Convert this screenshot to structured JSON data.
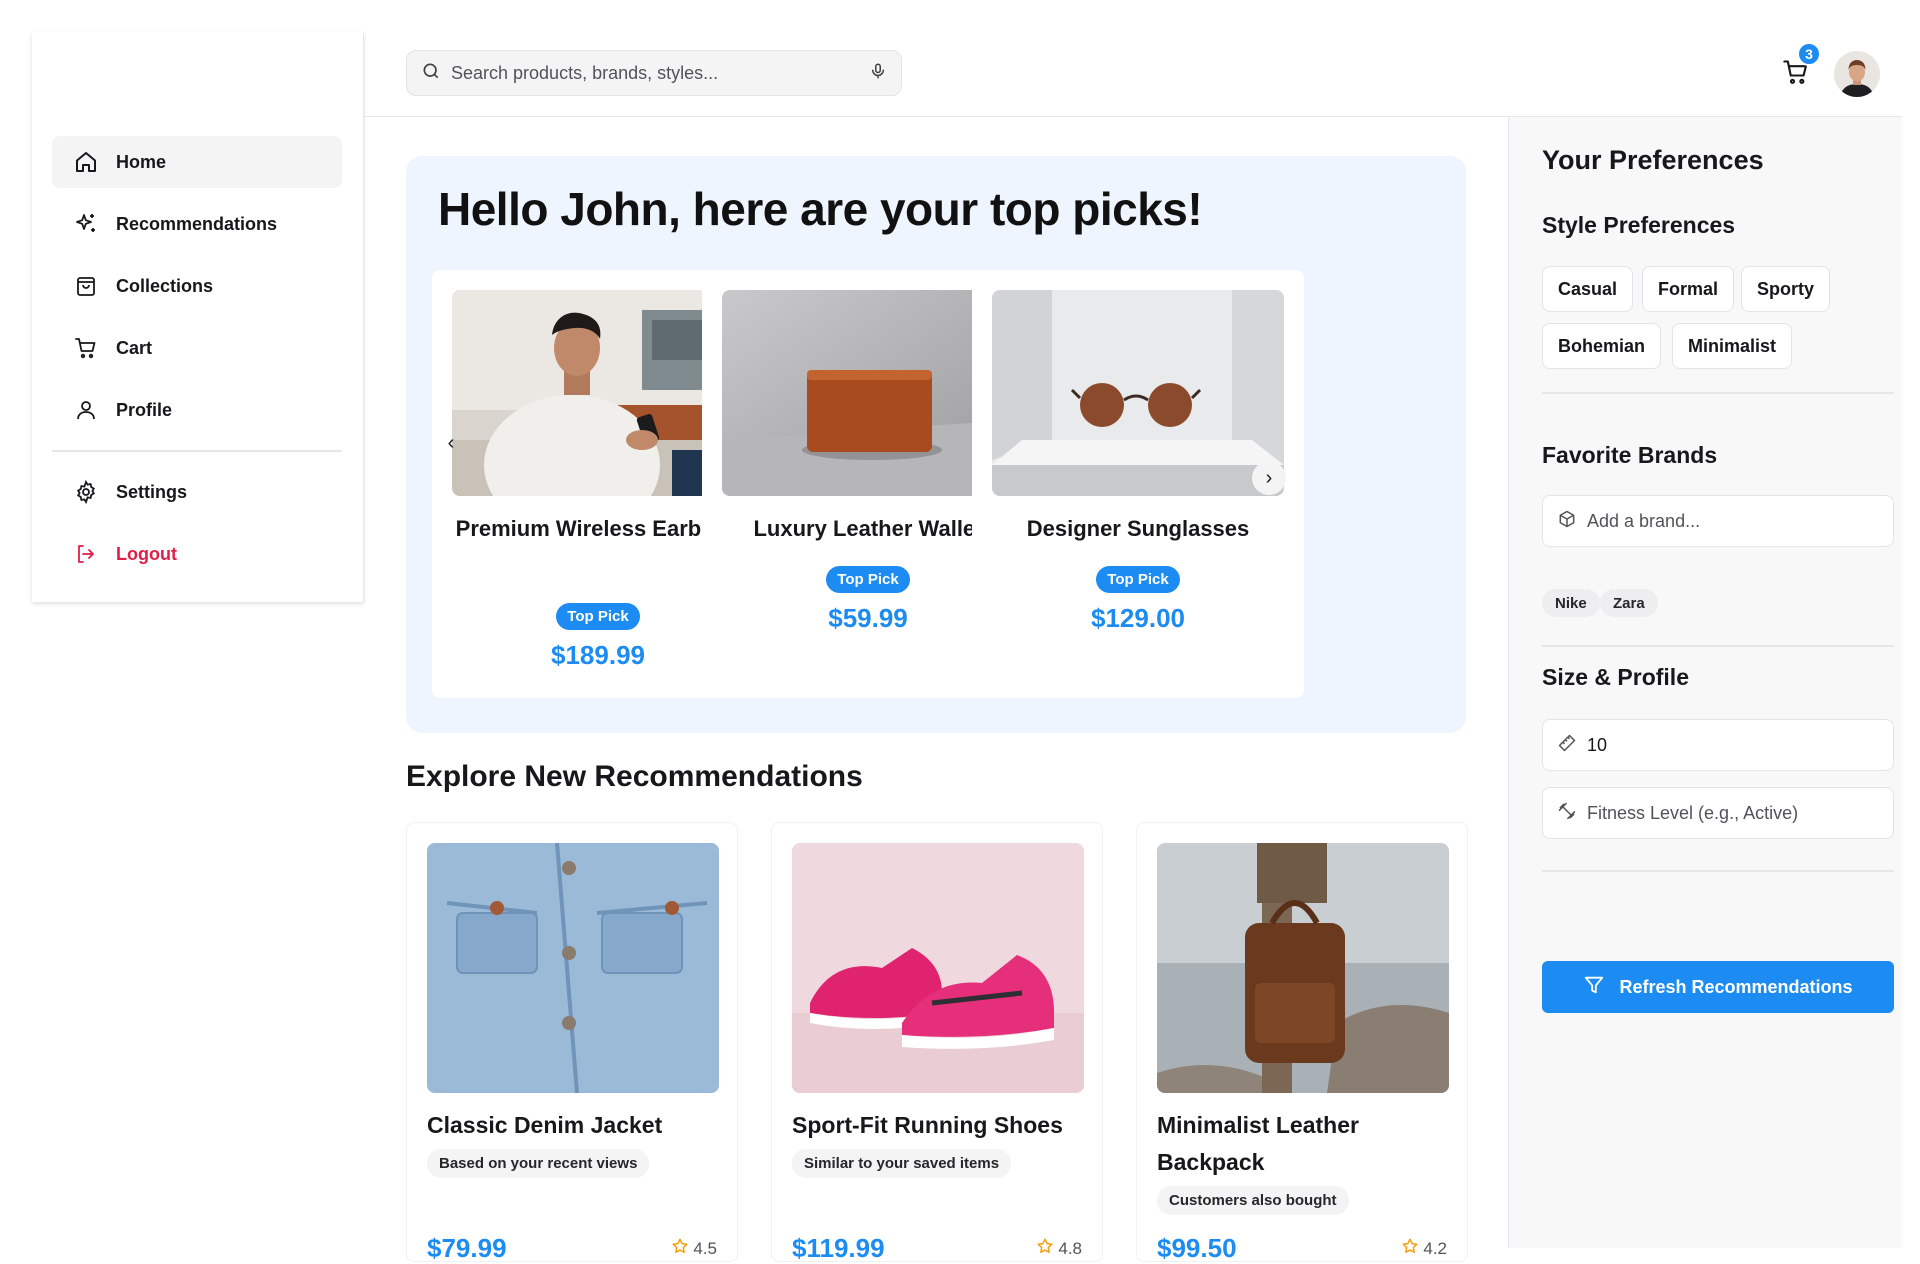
{
  "sidebar": {
    "items": [
      {
        "label": "Home",
        "icon": "home-icon"
      },
      {
        "label": "Recommendations",
        "icon": "sparkles-icon"
      },
      {
        "label": "Collections",
        "icon": "shopping-bag-icon"
      },
      {
        "label": "Cart",
        "icon": "cart-icon"
      },
      {
        "label": "Profile",
        "icon": "user-icon"
      }
    ],
    "settings_label": "Settings",
    "logout_label": "Logout"
  },
  "header": {
    "search_placeholder": "Search products, brands, styles...",
    "cart_count": "3"
  },
  "hero": {
    "title": "Hello John, here are your top picks!",
    "picks": [
      {
        "name": "Premium Wireless Earbuds",
        "badge": "Top Pick",
        "price": "$189.99"
      },
      {
        "name": "Luxury Leather Wallet",
        "badge": "Top Pick",
        "price": "$59.99"
      },
      {
        "name": "Designer Sunglasses",
        "badge": "Top Pick",
        "price": "$129.00"
      }
    ]
  },
  "explore": {
    "title": "Explore New Recommendations",
    "items": [
      {
        "name": "Classic Denim Jacket",
        "reason": "Based on your recent views",
        "price": "$79.99",
        "rating": "4.5"
      },
      {
        "name": "Sport-Fit Running Shoes",
        "reason": "Similar to your saved items",
        "price": "$119.99",
        "rating": "4.8"
      },
      {
        "name": "Minimalist Leather Backpack",
        "reason": "Customers also bought",
        "price": "$99.50",
        "rating": "4.2"
      }
    ]
  },
  "preferences": {
    "title": "Your Preferences",
    "style_title": "Style Preferences",
    "styles": [
      "Casual",
      "Formal",
      "Sporty",
      "Bohemian",
      "Minimalist"
    ],
    "brands_title": "Favorite Brands",
    "brand_placeholder": "Add a brand...",
    "brands": [
      "Nike",
      "Zara"
    ],
    "size_title": "Size & Profile",
    "size_value": "10",
    "fitness_placeholder": "Fitness Level (e.g., Active)",
    "refresh_label": "Refresh Recommendations"
  },
  "colors": {
    "accent": "#1d8cf2",
    "logout": "#e11d48",
    "hero_bg": "#eef5fe"
  }
}
